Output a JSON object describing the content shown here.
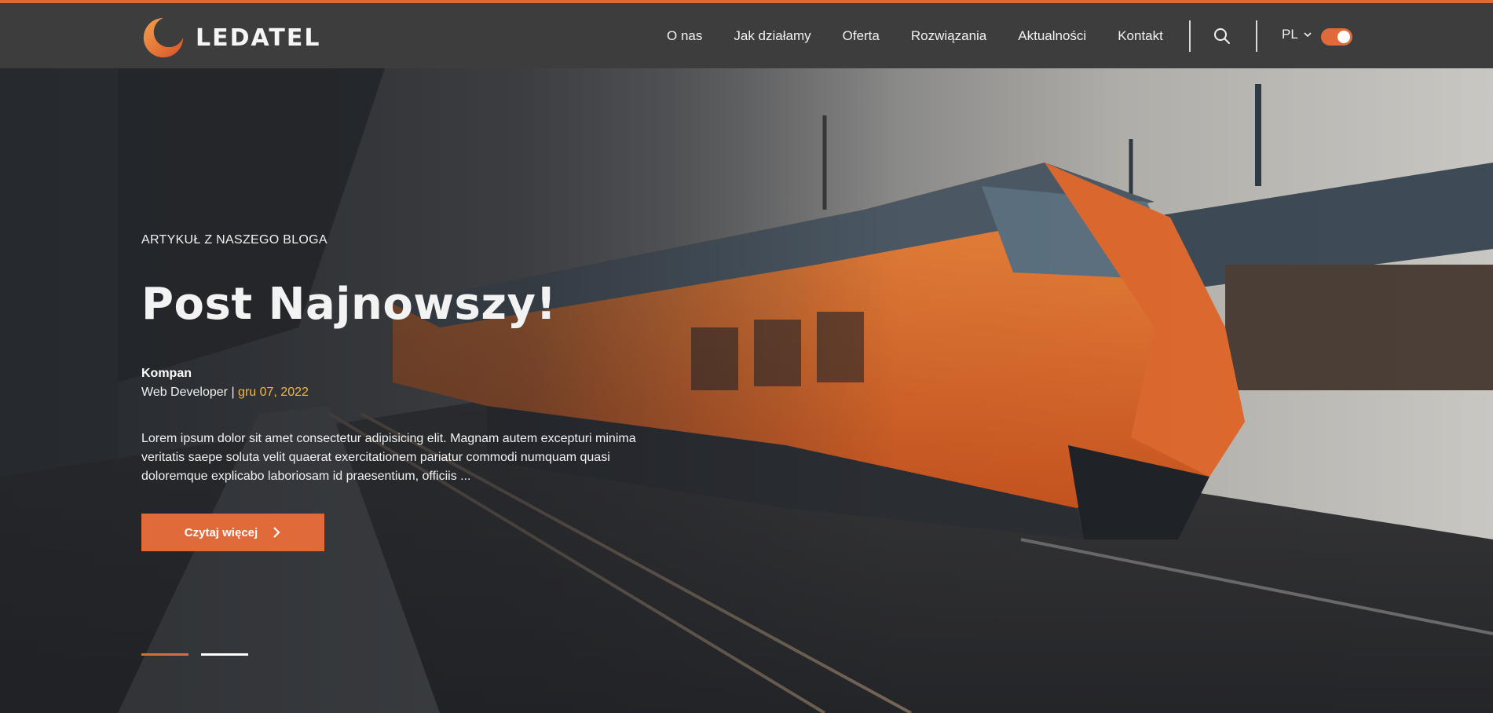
{
  "header": {
    "logo_text": "LEDATEL",
    "nav": [
      "O nas",
      "Jak działamy",
      "Oferta",
      "Rozwiązania",
      "Aktualności",
      "Kontakt"
    ],
    "language": "PL",
    "toggle_on": true,
    "accent_color": "#e06a3a"
  },
  "hero": {
    "eyebrow": "ARTYKUŁ Z NASZEGO BLOGA",
    "title": "Post Najnowszy!",
    "author": "Kompan",
    "role": "Web Developer",
    "separator": "|",
    "date": "gru 07, 2022",
    "excerpt": "Lorem ipsum dolor sit amet consectetur adipisicing elit. Magnam autem excepturi minima veritatis saepe soluta velit quaerat exercitationem pariatur commodi numquam quasi doloremque explicabo laboriosam id praesentium, officiis ...",
    "cta_label": "Czytaj więcej",
    "slider": {
      "count": 2,
      "active_index": 0
    }
  }
}
